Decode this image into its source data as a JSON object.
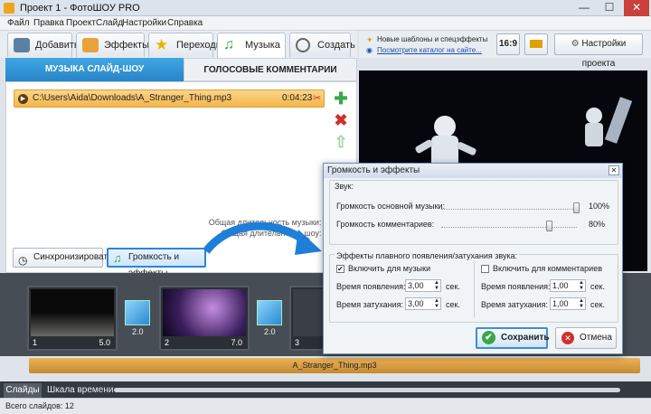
{
  "window": {
    "title": "Проект 1 - ФотоШОУ PRO",
    "minimize": "—",
    "maximize": "☐",
    "close": "✕"
  },
  "menu": [
    "Файл",
    "Правка",
    "Проект",
    "Слайд",
    "Настройки",
    "Справка"
  ],
  "tabs": [
    {
      "label": "Добавить"
    },
    {
      "label": "Эффекты"
    },
    {
      "label": "Переходы"
    },
    {
      "label": "Музыка"
    },
    {
      "label": "Создать"
    }
  ],
  "subtabs": {
    "music": "МУЗЫКА СЛАЙД-ШОУ",
    "voice": "ГОЛОСОВЫЕ КОММЕНТАРИИ"
  },
  "track": {
    "path": "C:\\Users\\Aida\\Downloads\\A_Stranger_Thing.mp3",
    "duration": "0:04:23"
  },
  "totals": {
    "music": "Общая длительность музыки: 0:04:23",
    "show": "Общая длительность шоу: 0:00:41"
  },
  "buttons": {
    "sync": "Синхронизировать",
    "volume": "Громкость и эффекты"
  },
  "topright": {
    "news1": "Новые шаблоны и спецэффекты",
    "news2": "Посмотрите каталог на сайте...",
    "ratio": "16:9",
    "settings": "Настройки проекта"
  },
  "filmstrip": {
    "slides": [
      {
        "num": "1",
        "dur": "5.0"
      },
      {
        "num": "2",
        "dur": "7.0"
      },
      {
        "num": "3",
        "dur": ""
      }
    ],
    "transitions": [
      "2.0",
      "2.0"
    ]
  },
  "audio_track": "A_Stranger_Thing.mp3",
  "bottom_tabs": {
    "slides": "Слайды",
    "timeline": "Шкала времени"
  },
  "status": "Всего слайдов: 12",
  "dialog": {
    "title": "Громкость и эффекты",
    "sound_group": "Звук:",
    "main_volume_label": "Громкость основной музыки:",
    "main_volume": "100%",
    "main_volume_level": 1.0,
    "comment_volume_label": "Громкость комментариев:",
    "comment_volume": "80%",
    "comment_volume_level": 0.8,
    "fade_group": "Эффекты плавного появления/затухания звука:",
    "music_check": "Включить для музыки",
    "comment_check": "Включить для комментариев",
    "fade_in_label": "Время появления:",
    "fade_out_label": "Время затухания:",
    "music_fade_in": "3,00",
    "music_fade_out": "3,00",
    "comment_fade_in": "1,00",
    "comment_fade_out": "1,00",
    "sec": "сек.",
    "save": "Сохранить",
    "cancel": "Отмена"
  }
}
